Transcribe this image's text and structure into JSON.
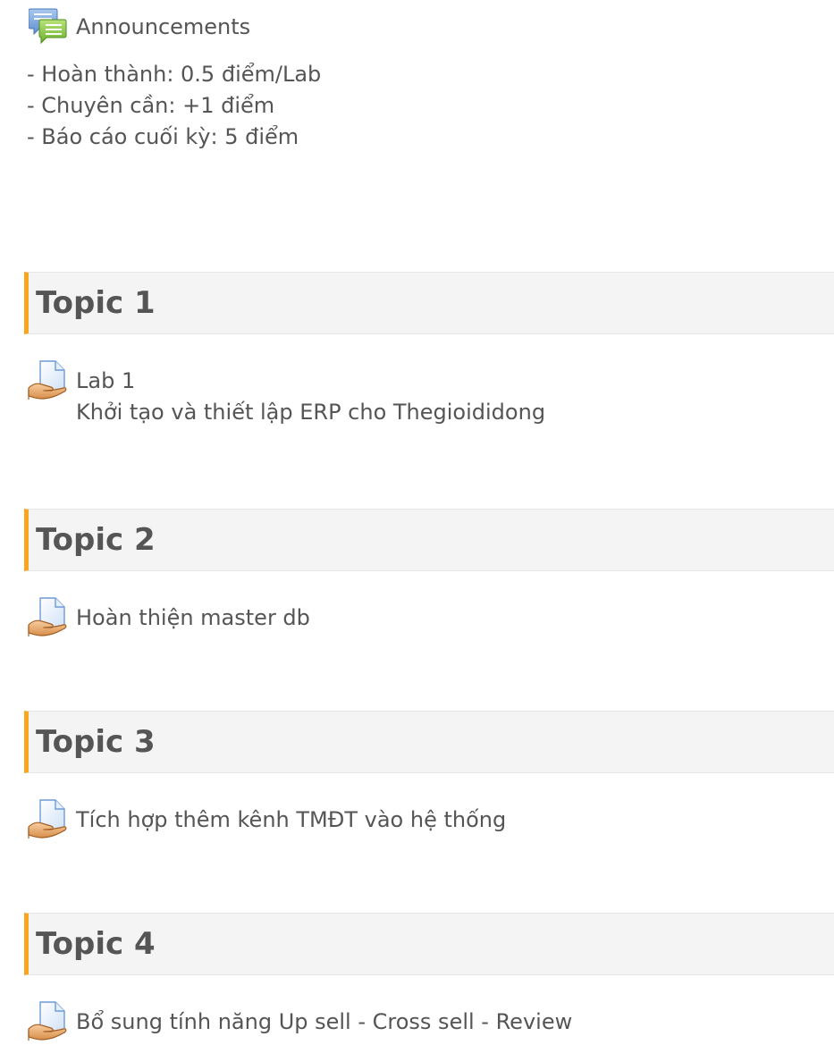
{
  "announcements": {
    "icon": "forum-icon",
    "label": "Announcements"
  },
  "summary": {
    "lines": [
      "- Hoàn thành: 0.5 điểm/Lab",
      "- Chuyên cần: +1 điểm",
      "- Báo cáo cuối kỳ: 5 điểm"
    ]
  },
  "topics": [
    {
      "title": "Topic 1",
      "activity": {
        "icon": "assignment-icon",
        "lines": [
          "Lab 1",
          "Khởi tạo và thiết lập ERP cho Thegioididong"
        ]
      }
    },
    {
      "title": "Topic 2",
      "activity": {
        "icon": "assignment-icon",
        "lines": [
          "Hoàn thiện master db"
        ]
      }
    },
    {
      "title": "Topic 3",
      "activity": {
        "icon": "assignment-icon",
        "lines": [
          "Tích hợp thêm kênh TMĐT vào hệ thống"
        ]
      }
    },
    {
      "title": "Topic 4",
      "activity": {
        "icon": "assignment-icon",
        "lines": [
          "Bổ sung tính năng Up sell - Cross sell - Review"
        ]
      }
    }
  ],
  "colors": {
    "accent": "#f9a61f",
    "header_bg": "#f4f4f4",
    "text": "#555555"
  }
}
